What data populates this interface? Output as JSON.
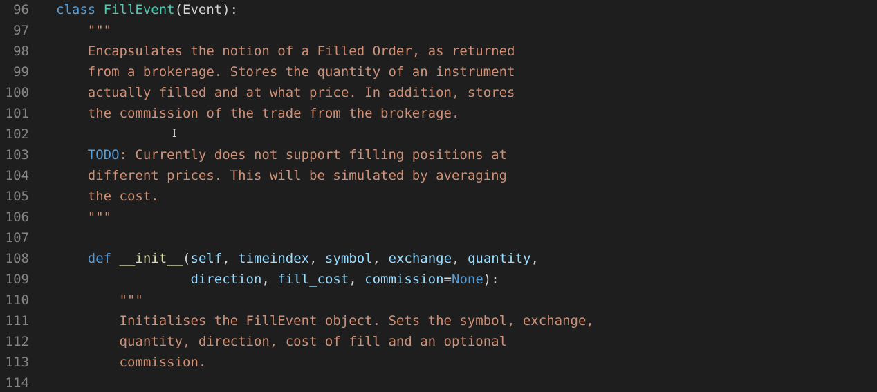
{
  "editor": {
    "lines": [
      {
        "num": "96",
        "indent": "",
        "tokens": [
          {
            "t": "class ",
            "c": "kw"
          },
          {
            "t": "FillEvent",
            "c": "cls"
          },
          {
            "t": "(Event):",
            "c": "plain"
          }
        ]
      },
      {
        "num": "97",
        "indent": "    ",
        "tokens": [
          {
            "t": "\"\"\"",
            "c": "str"
          }
        ]
      },
      {
        "num": "98",
        "indent": "    ",
        "tokens": [
          {
            "t": "Encapsulates the notion of a Filled Order, as returned",
            "c": "str"
          }
        ]
      },
      {
        "num": "99",
        "indent": "    ",
        "tokens": [
          {
            "t": "from a brokerage. Stores the quantity of an instrument",
            "c": "str"
          }
        ]
      },
      {
        "num": "100",
        "indent": "    ",
        "tokens": [
          {
            "t": "actually filled and at what price. In addition, stores",
            "c": "str"
          }
        ]
      },
      {
        "num": "101",
        "indent": "    ",
        "tokens": [
          {
            "t": "the commission of the trade from the brokerage.",
            "c": "str"
          }
        ]
      },
      {
        "num": "102",
        "indent": "",
        "tokens": []
      },
      {
        "num": "103",
        "indent": "    ",
        "tokens": [
          {
            "t": "TODO",
            "c": "kw"
          },
          {
            "t": ": Currently does not support filling positions at",
            "c": "str"
          }
        ]
      },
      {
        "num": "104",
        "indent": "    ",
        "tokens": [
          {
            "t": "different prices. This will be simulated by averaging",
            "c": "str"
          }
        ]
      },
      {
        "num": "105",
        "indent": "    ",
        "tokens": [
          {
            "t": "the cost.",
            "c": "str"
          }
        ]
      },
      {
        "num": "106",
        "indent": "    ",
        "tokens": [
          {
            "t": "\"\"\"",
            "c": "str"
          }
        ]
      },
      {
        "num": "107",
        "indent": "",
        "tokens": []
      },
      {
        "num": "108",
        "indent": "    ",
        "tokens": [
          {
            "t": "def ",
            "c": "kw"
          },
          {
            "t": "__init__",
            "c": "fn"
          },
          {
            "t": "(",
            "c": "plain"
          },
          {
            "t": "self",
            "c": "id"
          },
          {
            "t": ", ",
            "c": "plain"
          },
          {
            "t": "timeindex",
            "c": "id"
          },
          {
            "t": ", ",
            "c": "plain"
          },
          {
            "t": "symbol",
            "c": "id"
          },
          {
            "t": ", ",
            "c": "plain"
          },
          {
            "t": "exchange",
            "c": "id"
          },
          {
            "t": ", ",
            "c": "plain"
          },
          {
            "t": "quantity",
            "c": "id"
          },
          {
            "t": ",",
            "c": "plain"
          }
        ]
      },
      {
        "num": "109",
        "indent": "                 ",
        "tokens": [
          {
            "t": "direction",
            "c": "id"
          },
          {
            "t": ", ",
            "c": "plain"
          },
          {
            "t": "fill_cost",
            "c": "id"
          },
          {
            "t": ", ",
            "c": "plain"
          },
          {
            "t": "commission",
            "c": "id"
          },
          {
            "t": "=",
            "c": "plain"
          },
          {
            "t": "None",
            "c": "kw"
          },
          {
            "t": "):",
            "c": "plain"
          }
        ]
      },
      {
        "num": "110",
        "indent": "        ",
        "tokens": [
          {
            "t": "\"\"\"",
            "c": "str"
          }
        ]
      },
      {
        "num": "111",
        "indent": "        ",
        "tokens": [
          {
            "t": "Initialises the FillEvent object. Sets the symbol, exchange,",
            "c": "str"
          }
        ]
      },
      {
        "num": "112",
        "indent": "        ",
        "tokens": [
          {
            "t": "quantity, direction, cost of fill and an optional",
            "c": "str"
          }
        ]
      },
      {
        "num": "113",
        "indent": "        ",
        "tokens": [
          {
            "t": "commission.",
            "c": "str"
          }
        ]
      },
      {
        "num": "114",
        "indent": "",
        "tokens": []
      }
    ],
    "cursor_icon": "text-cursor-icon"
  }
}
